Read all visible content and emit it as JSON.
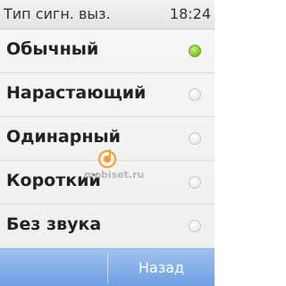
{
  "status_bar": {
    "title": "Тип сигн. выз.",
    "time": "18:24"
  },
  "options": [
    {
      "label": "Обычный",
      "selected": true
    },
    {
      "label": "Нарастающий",
      "selected": false
    },
    {
      "label": "Одинарный",
      "selected": false
    },
    {
      "label": "Короткий",
      "selected": false
    },
    {
      "label": "Без звука",
      "selected": false
    }
  ],
  "watermark": {
    "text": "mobiset.ru"
  },
  "softkeys": {
    "right_label": "Назад"
  },
  "colors": {
    "selected_radio": "#7ac22c",
    "softkey_bar": "#7fa8e5"
  }
}
